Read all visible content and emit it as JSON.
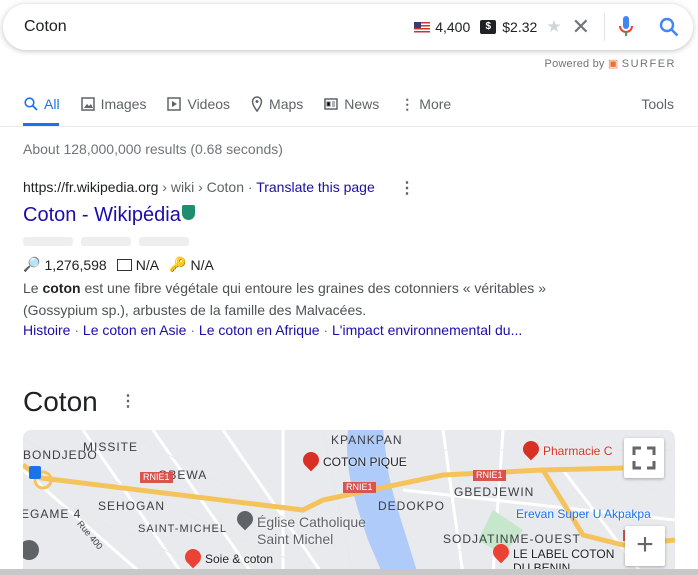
{
  "search": {
    "query": "Coton",
    "volume": "4,400",
    "cpc": "$2.32",
    "dollar_badge": "$",
    "powered_by": "Powered by",
    "surfer": "SURFER"
  },
  "tabs": [
    {
      "label": "All",
      "icon": "search-icon"
    },
    {
      "label": "Images",
      "icon": "image-icon"
    },
    {
      "label": "Videos",
      "icon": "play-icon"
    },
    {
      "label": "Maps",
      "icon": "map-pin-icon"
    },
    {
      "label": "News",
      "icon": "news-icon"
    },
    {
      "label": "More",
      "icon": "more-vert-icon"
    }
  ],
  "tools": "Tools",
  "stats": "About 128,000,000 results (0.68 seconds)",
  "result": {
    "url": "https://fr.wikipedia.org",
    "path": " › wiki › Coton",
    "sep": " · ",
    "translate": "Translate this page",
    "title": "Coton - Wikipédia",
    "searches": "1,276,598",
    "metric2": "N/A",
    "metric3": "N/A",
    "snippet_pre": "Le ",
    "snippet_bold": "coton",
    "snippet_post": " est une fibre végétale qui entoure les graines des cotonniers « véritables » (Gossypium sp.), arbustes de la famille des Malvacées.",
    "links": [
      "Histoire",
      "Le coton en Asie",
      "Le coton en Afrique",
      "L'impact environnemental du..."
    ],
    "link_sep": " · "
  },
  "knowledge_panel": {
    "title": "Coton"
  },
  "map": {
    "labels": [
      "MISSITE",
      "BONDJEDO",
      "GBEWA",
      "SEHOGAN",
      "EGAME 4",
      "SAINT-MICHEL",
      "KPANKPAN",
      "DEDOKPO",
      "GBEDJEWIN",
      "SODJATINME-OUEST",
      "Rue 400"
    ],
    "road": "RNIE1",
    "places": [
      {
        "name": "COTON PIQUE",
        "color": "#202124"
      },
      {
        "name": "Pharmacie C",
        "color": "#d93025"
      },
      {
        "name": "Église Catholique",
        "color": "#5f6368"
      },
      {
        "name": "Saint Michel",
        "color": "#5f6368"
      },
      {
        "name": "Erevan Super U Akpakpa",
        "color": "#1a73e8"
      },
      {
        "name": "Soie & coton",
        "color": "#202124"
      },
      {
        "name": "LE LABEL COTON",
        "color": "#202124"
      },
      {
        "name": "DU BENIN",
        "color": "#202124"
      }
    ]
  }
}
